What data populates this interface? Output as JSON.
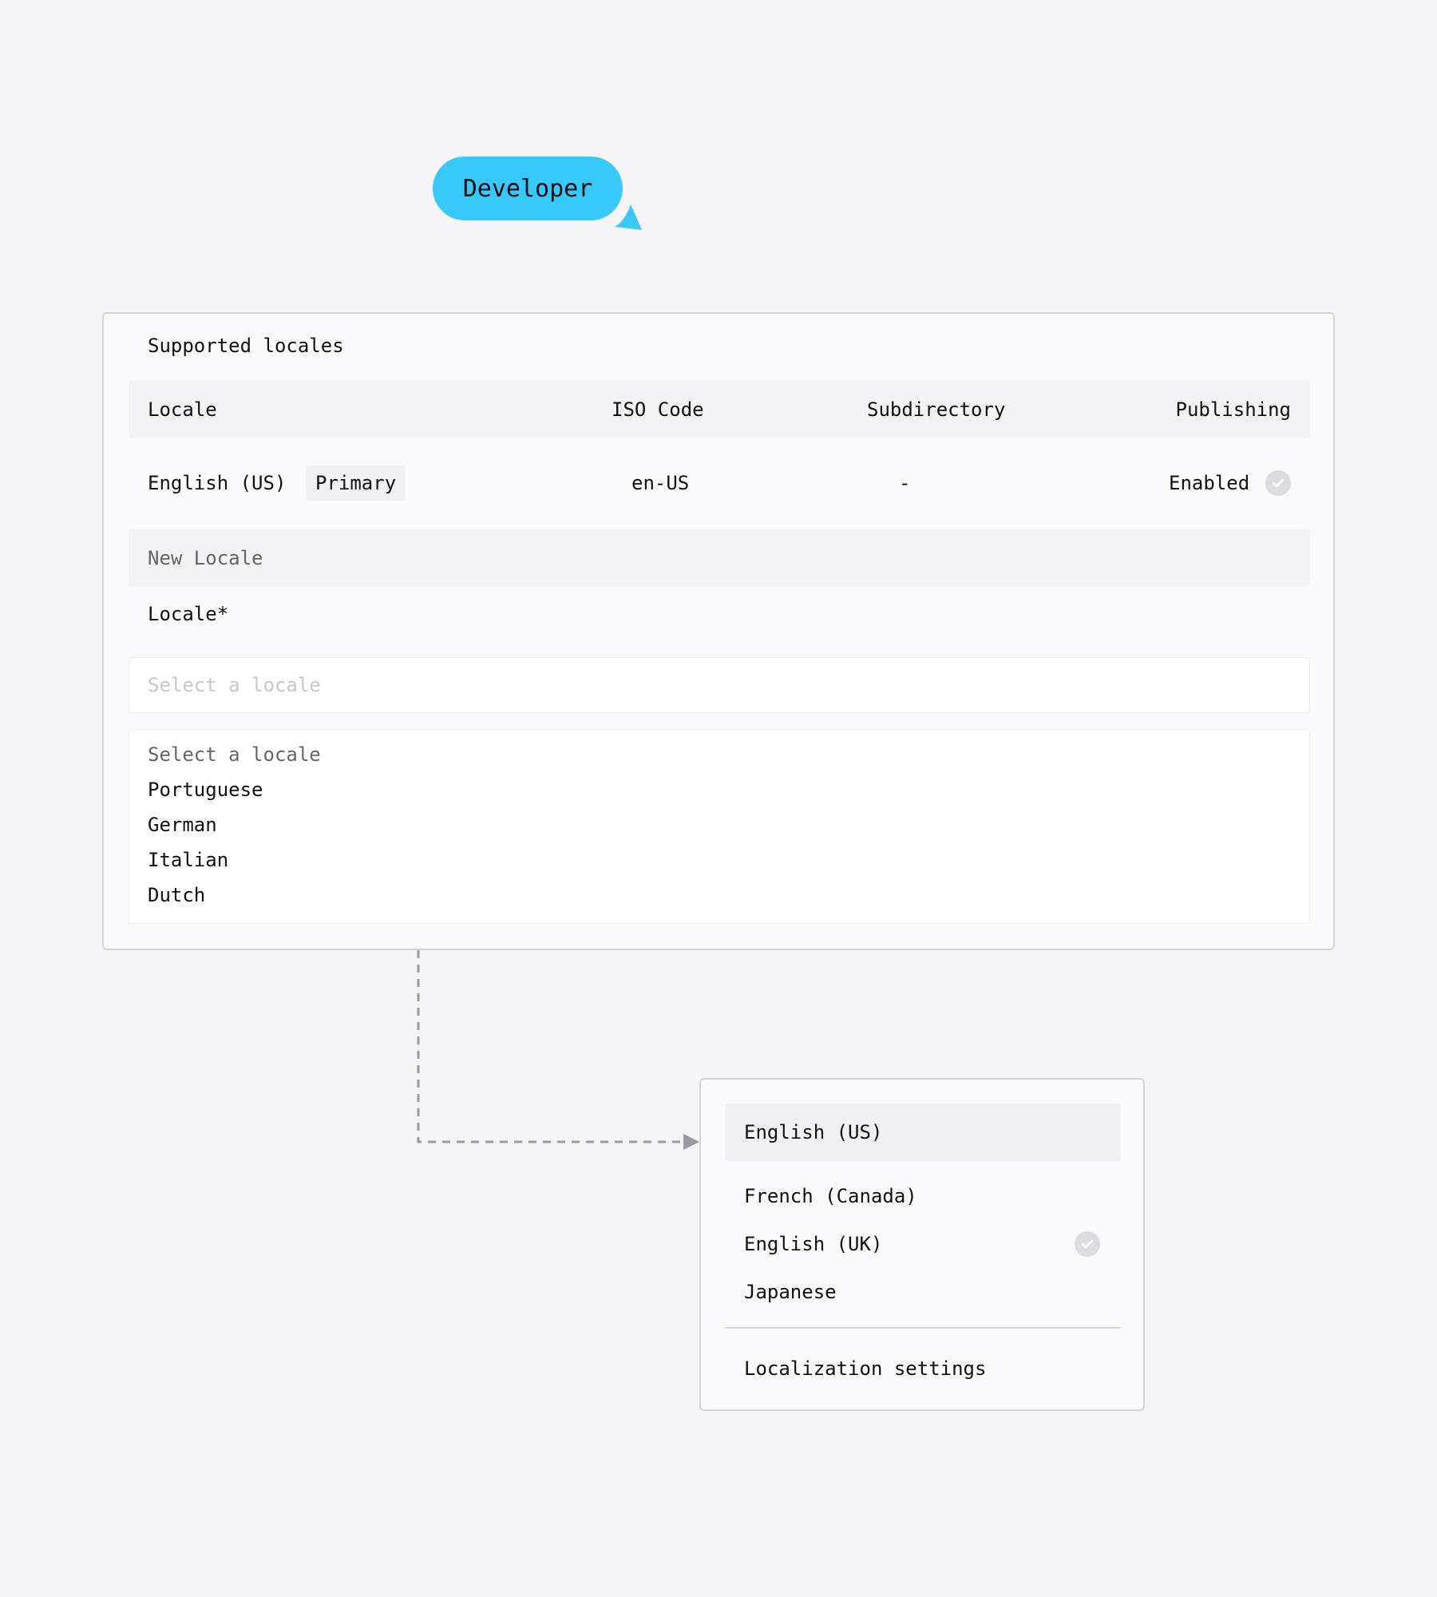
{
  "role_tag": {
    "label": "Developer",
    "color": "#38c9fb"
  },
  "supported_locales": {
    "title": "Supported locales",
    "columns": {
      "locale": "Locale",
      "iso_code": "ISO Code",
      "subdirectory": "Subdirectory",
      "publishing": "Publishing"
    },
    "rows": [
      {
        "locale": "English (US)",
        "badge": "Primary",
        "iso_code": "en-US",
        "subdirectory": "-",
        "publishing": "Enabled",
        "publishing_icon": "check-circle-icon"
      }
    ]
  },
  "new_locale": {
    "section_label": "New Locale",
    "field_label": "Locale*",
    "select_placeholder": "Select a locale",
    "options": [
      "Select a locale",
      "Portuguese",
      "German",
      "Italian",
      "Dutch"
    ]
  },
  "locale_menu": {
    "items": [
      {
        "label": "English (US)",
        "active": true,
        "checked": false
      },
      {
        "label": "French (Canada)",
        "active": false,
        "checked": false
      },
      {
        "label": "English (UK)",
        "active": false,
        "checked": true
      },
      {
        "label": "Japanese",
        "active": false,
        "checked": false
      }
    ],
    "footer_label": "Localization settings"
  }
}
